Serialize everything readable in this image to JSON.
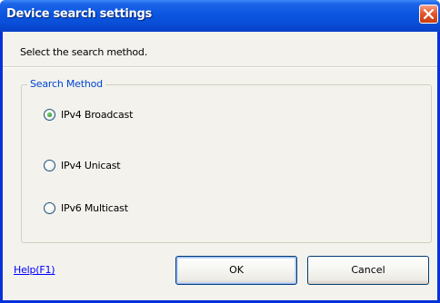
{
  "window": {
    "title": "Device search settings"
  },
  "dialog": {
    "instruction": "Select the search method."
  },
  "search_method": {
    "legend": "Search Method",
    "options": [
      {
        "label": "IPv4 Broadcast",
        "selected": true
      },
      {
        "label": "IPv4 Unicast",
        "selected": false
      },
      {
        "label": "IPv6 Multicast",
        "selected": false
      }
    ]
  },
  "footer": {
    "help_label": "Help(F1)",
    "ok_label": "OK",
    "cancel_label": "Cancel"
  },
  "colors": {
    "titlebar": "#0a56e0",
    "legend": "#0046d5",
    "link": "#0000ff",
    "close_button": "#e5582e",
    "radio_selected": "#2e9e2e"
  },
  "icons": {
    "close": "close-icon"
  }
}
